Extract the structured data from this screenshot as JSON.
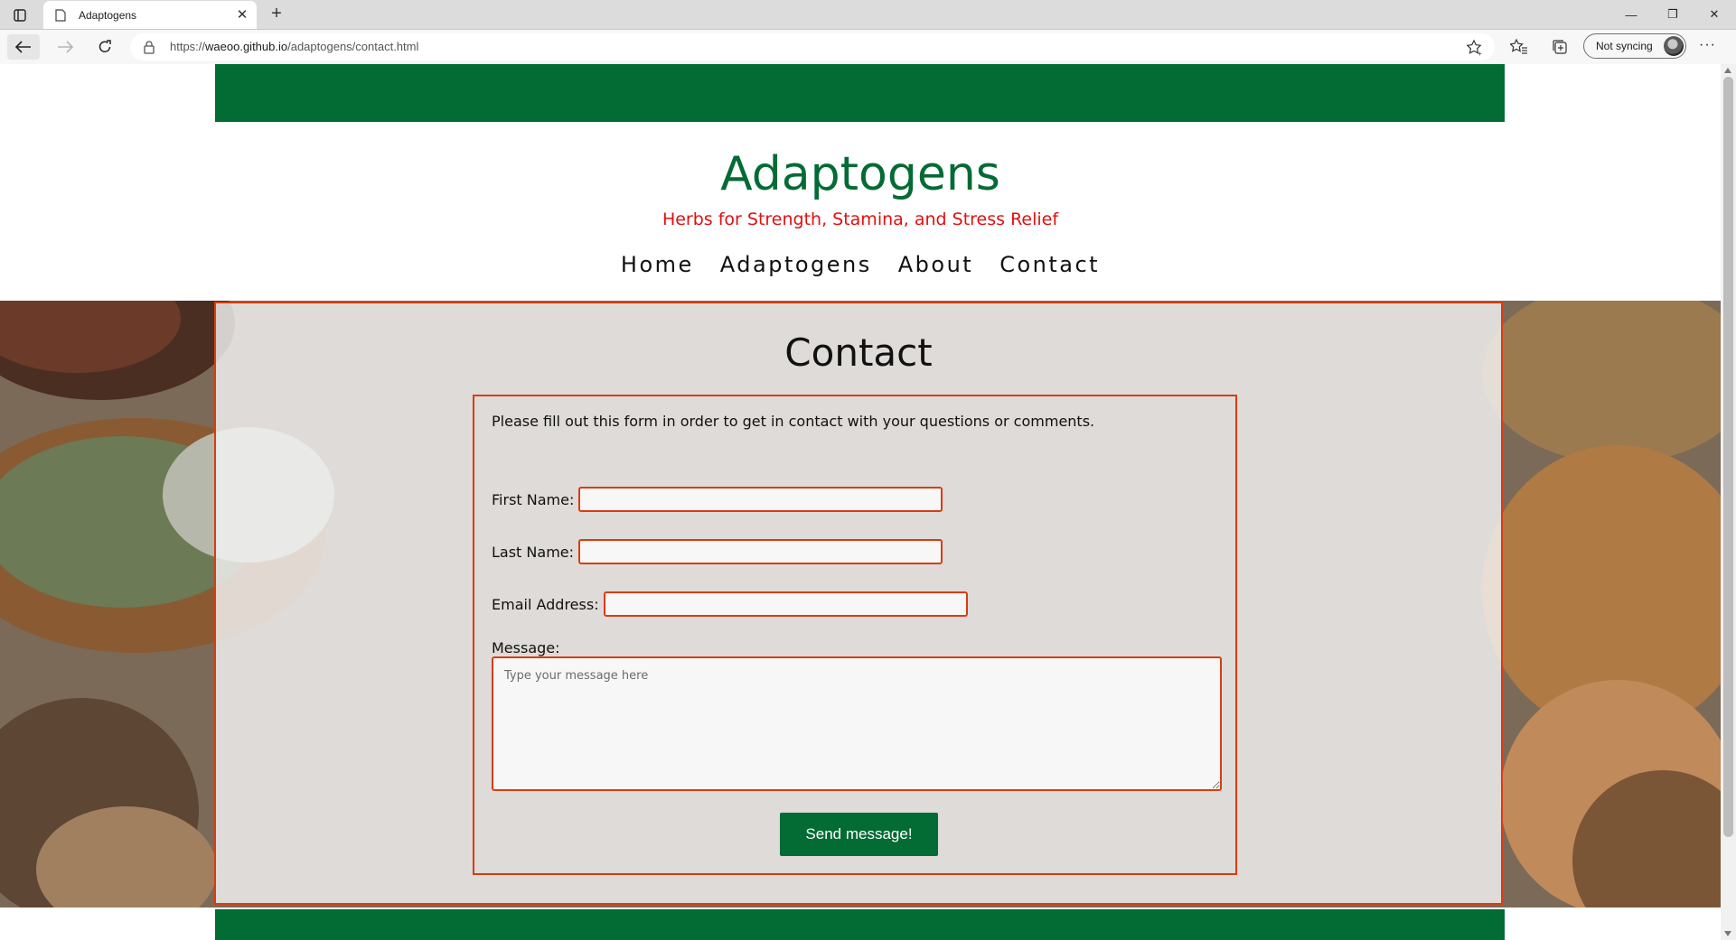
{
  "browser": {
    "tab_title": "Adaptogens",
    "new_tab_symbol": "+",
    "tab_close_symbol": "✕",
    "url_protocol": "https://",
    "url_host": "waeoo.github.io",
    "url_path": "/adaptogens/contact.html",
    "profile_label": "Not syncing",
    "more_symbol": "···",
    "window_controls": {
      "minimize": "—",
      "restore": "❐",
      "close": "✕"
    }
  },
  "site": {
    "title": "Adaptogens",
    "tagline": "Herbs for Strength, Stamina, and Stress Relief",
    "nav": [
      "Home",
      "Adaptogens",
      "About",
      "Contact"
    ]
  },
  "contact": {
    "heading": "Contact",
    "intro": "Please fill out this form in order to get in contact with your questions or comments.",
    "first_name_label": "First Name:",
    "first_name_value": "",
    "last_name_label": "Last Name:",
    "last_name_value": "",
    "email_label": "Email Address:",
    "email_value": "",
    "message_label": "Message:",
    "message_placeholder": "Type your message here",
    "send_label": "Send message!"
  },
  "colors": {
    "brand_green": "#036b34",
    "accent_red": "#e01010",
    "border_orange": "#d83d10"
  }
}
